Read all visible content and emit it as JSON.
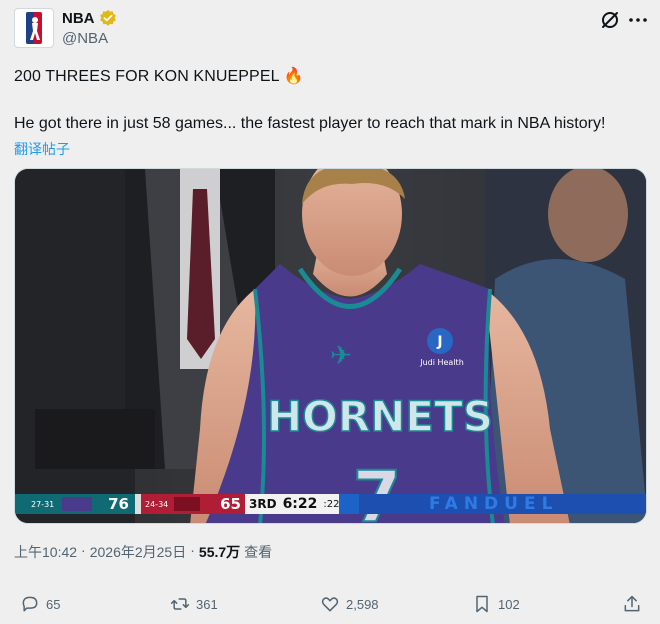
{
  "author": {
    "display_name": "NBA",
    "handle": "@NBA",
    "logo_icon": "nba-logo-icon",
    "verified_color": "#e2b719"
  },
  "tweet": {
    "line1": "200 THREES FOR KON KNUEPPEL 🔥",
    "line2": "He got there in just 58 games... the fastest player to reach that mark in NBA history!",
    "translate_label": "翻译帖子"
  },
  "media": {
    "jersey_team": "HORNETS",
    "jersey_number": "7",
    "sponsor_patch": "Judi Health",
    "courtside_ad": "FANDUEL",
    "scorebug": {
      "home_record": "27-31",
      "home_score": "76",
      "away_record": "24-34",
      "away_score": "65",
      "quarter": "3RD",
      "clock": "6:22",
      "shot_clock": ":22"
    }
  },
  "meta": {
    "time": "上午10:42",
    "separator1": "·",
    "date": "2026年2月25日",
    "separator2": "·",
    "views_count": "55.7万",
    "views_label": "查看"
  },
  "actions": {
    "replies": "65",
    "reposts": "361",
    "likes": "2,598",
    "bookmarks": "102"
  },
  "colors": {
    "link": "#1d9bf0",
    "secondary_text": "#536471",
    "hornets_purple": "#4a3a8c",
    "hornets_teal": "#1a8a94",
    "bulls_red": "#b01e35"
  }
}
